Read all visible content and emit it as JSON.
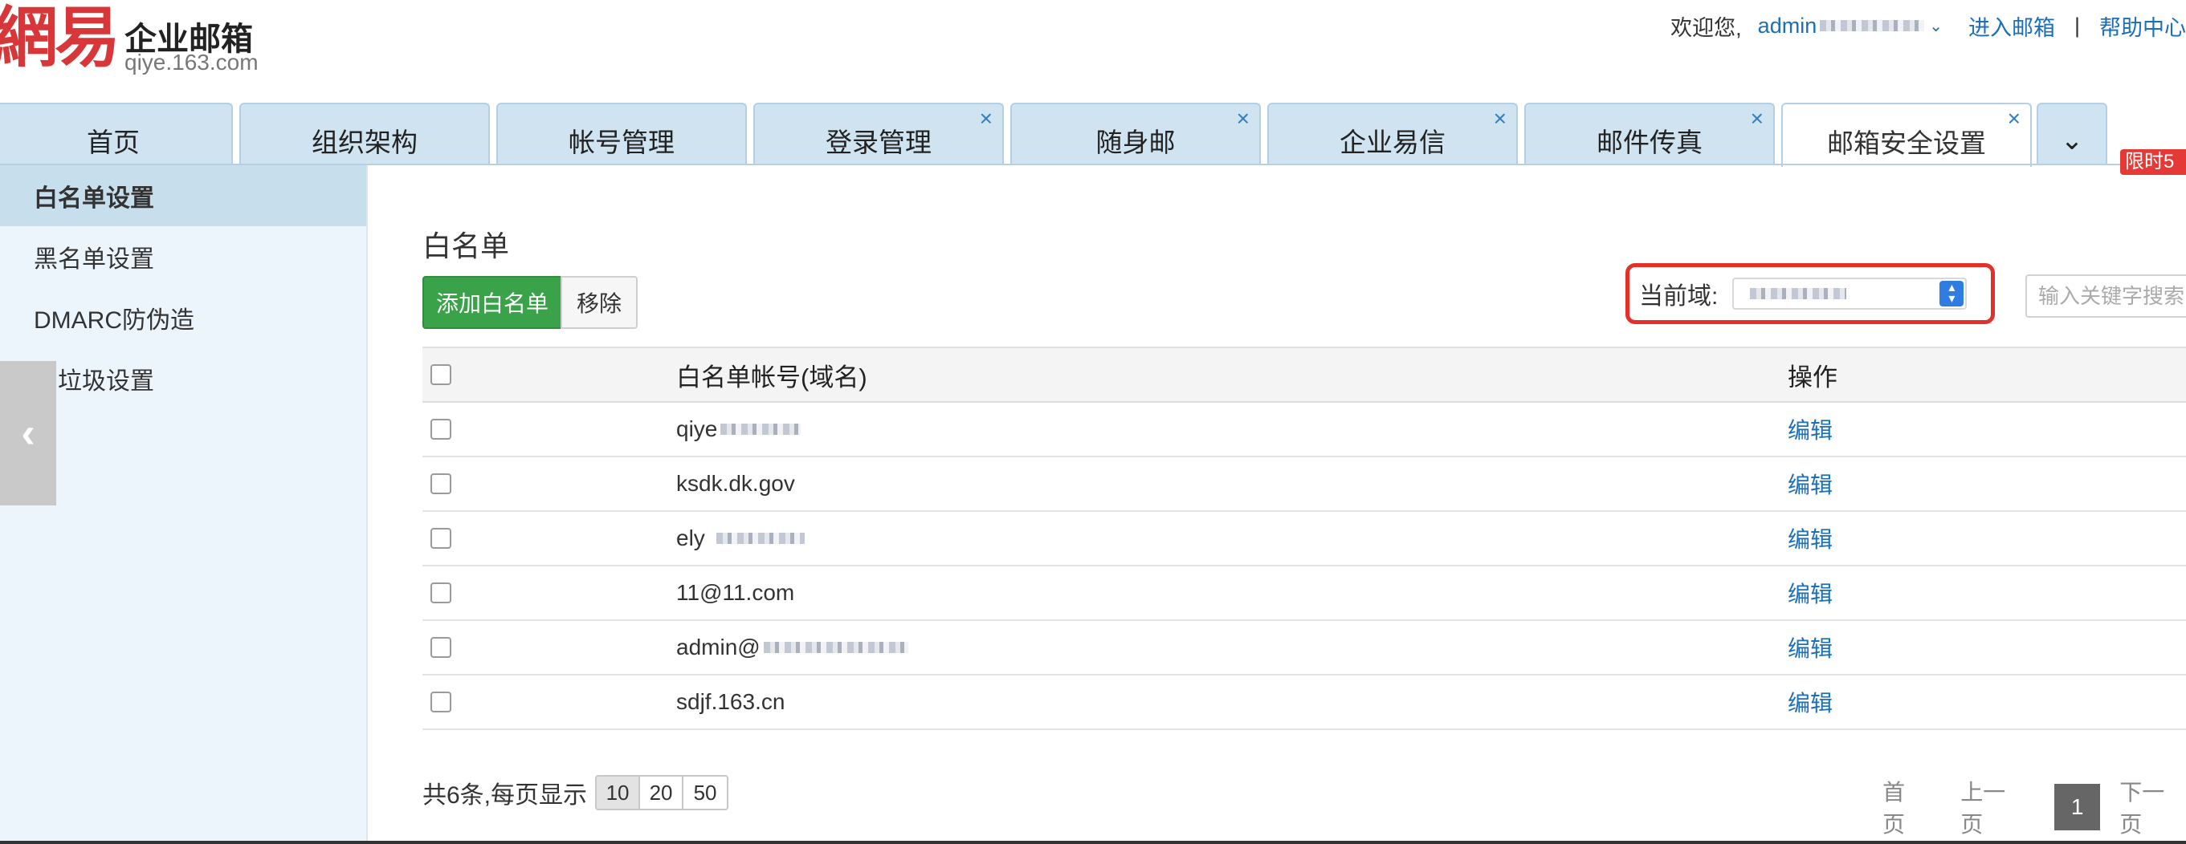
{
  "logo": {
    "glyph": "網易",
    "title": "企业邮箱",
    "subtitle": "qiye.163.com"
  },
  "topbar": {
    "welcome": "欢迎您,",
    "user_prefix": "admin",
    "enter_mailbox": "进入邮箱",
    "separator": "|",
    "help": "帮助中心"
  },
  "tabs": [
    {
      "label": "首页",
      "closable": false,
      "active": false
    },
    {
      "label": "组织架构",
      "closable": false,
      "active": false
    },
    {
      "label": "帐号管理",
      "closable": false,
      "active": false
    },
    {
      "label": "登录管理",
      "closable": true,
      "active": false
    },
    {
      "label": "随身邮",
      "closable": true,
      "active": false
    },
    {
      "label": "企业易信",
      "closable": true,
      "active": false
    },
    {
      "label": "邮件传真",
      "closable": true,
      "active": false
    },
    {
      "label": "邮箱安全设置",
      "closable": true,
      "active": true
    }
  ],
  "tab_close_glyph": "×",
  "tab_more_glyph": "⌄",
  "promo_label": "限时5",
  "sidebar": {
    "items": [
      {
        "label": "白名单设置",
        "active": true
      },
      {
        "label": "黑名单设置",
        "active": false
      },
      {
        "label": "DMARC防伪造",
        "active": false
      },
      {
        "label": "反垃圾设置",
        "active": false
      }
    ],
    "collapse_glyph": "‹"
  },
  "main": {
    "heading": "白名单",
    "add_button": "添加白名单",
    "remove_button": "移除",
    "domain_label": "当前域:",
    "search_placeholder": "输入关键字搜索"
  },
  "table": {
    "columns": [
      "白名单帐号(域名)",
      "操作"
    ],
    "rows": [
      {
        "account": "qiye",
        "action": "编辑"
      },
      {
        "account": "ksdk.dk.gov",
        "action": "编辑"
      },
      {
        "account": "ely",
        "action": "编辑"
      },
      {
        "account": "11@11.com",
        "action": "编辑"
      },
      {
        "account": "admin@",
        "action": "编辑"
      },
      {
        "account": "sdjf.163.cn",
        "action": "编辑"
      }
    ]
  },
  "footer": {
    "count_text": "共6条,每页显示",
    "page_sizes": [
      "10",
      "20",
      "50"
    ],
    "selected_page_size": "10",
    "first_page": "首页",
    "prev_page": "上一页",
    "current_page": "1",
    "next_page": "下一页"
  },
  "colors": {
    "brand_red": "#d8373a",
    "link_blue": "#1a6fb8",
    "tab_blue": "#cfe3f1",
    "sidebar_bg": "#ecf5fb",
    "add_green": "#3aa349",
    "highlight_red": "#e5302a"
  }
}
